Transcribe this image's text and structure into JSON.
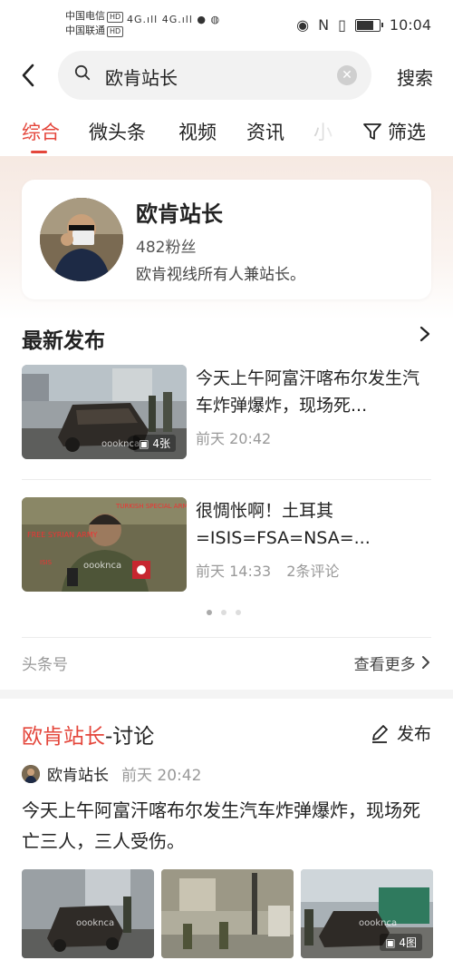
{
  "status_bar": {
    "carrier1": "中国电信",
    "carrier2": "中国联通",
    "hd": "HD",
    "signal1": "4G",
    "signal2": "4G",
    "time": "10:04",
    "nfc": "N"
  },
  "search": {
    "query": "欧肯站长",
    "submit_label": "搜索"
  },
  "tabs": [
    {
      "label": "综合",
      "active": true
    },
    {
      "label": "微头条"
    },
    {
      "label": "视频"
    },
    {
      "label": "资讯"
    },
    {
      "label": "小"
    }
  ],
  "filter_label": "筛选",
  "profile": {
    "name": "欧肯站长",
    "fans": "482粉丝",
    "bio": "欧肯视线所有人兼站长。"
  },
  "latest": {
    "title": "最新发布",
    "items": [
      {
        "title": "今天上午阿富汗喀布尔发生汽车炸弹爆炸，现场死...",
        "time": "前天 20:42",
        "comments": "",
        "badge": "4张",
        "watermark": "oooknca"
      },
      {
        "title": "很惆怅啊！土耳其=ISIS=FSA=NSA=...",
        "time": "前天 14:33",
        "comments": "2条评论",
        "badge": "",
        "watermark": "oooknca"
      }
    ],
    "footer_label": "头条号",
    "more_label": "查看更多"
  },
  "discussion": {
    "title_red": "欧肯站长",
    "title_black": "-讨论",
    "publish_label": "发布",
    "post": {
      "author": "欧肯站长",
      "time": "前天 20:42",
      "text": "今天上午阿富汗喀布尔发生汽车炸弹爆炸，现场死亡三人，三人受伤。",
      "image_badge": "4图",
      "watermark": "oooknca"
    }
  },
  "colors": {
    "accent": "#e4463b"
  }
}
